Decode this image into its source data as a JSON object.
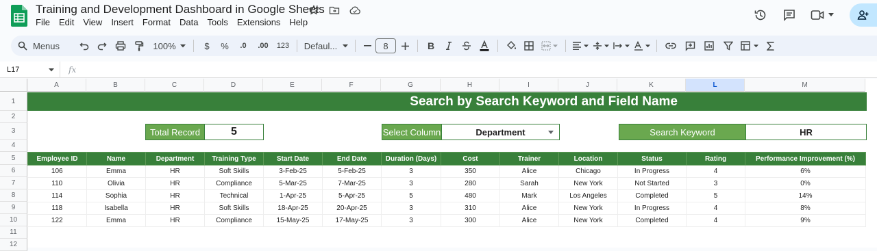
{
  "app": {
    "title": "Training and Development Dashboard in Google Sheets",
    "menu": [
      "File",
      "Edit",
      "View",
      "Insert",
      "Format",
      "Data",
      "Tools",
      "Extensions",
      "Help"
    ]
  },
  "toolbar": {
    "menus_label": "Menus",
    "zoom": "100%",
    "currency": "$",
    "percent": "%",
    "dec_decrease": ".0",
    "dec_increase": ".00",
    "number_format": "123",
    "font": "Defaul...",
    "font_size": "8",
    "bold": "B"
  },
  "formula_bar": {
    "cell_ref": "L17",
    "fx": "fx",
    "formula": ""
  },
  "columns": [
    "A",
    "B",
    "C",
    "D",
    "E",
    "F",
    "G",
    "H",
    "I",
    "J",
    "K",
    "L",
    "M"
  ],
  "selected_column": "L",
  "rows": [
    "1",
    "2",
    "3",
    "4",
    "5",
    "6",
    "7",
    "8",
    "9",
    "10",
    "11",
    "12"
  ],
  "dashboard": {
    "banner": "Search by Search Keyword and Field Name",
    "total_record_label": "Total Record",
    "total_record_value": "5",
    "select_column_label": "Select Column",
    "select_column_value": "Department",
    "search_keyword_label": "Search Keyword",
    "search_keyword_value": "HR"
  },
  "table": {
    "headers": [
      "Employee ID",
      "Name",
      "Department",
      "Training Type",
      "Start Date",
      "End Date",
      "Duration (Days)",
      "Cost",
      "Trainer",
      "Location",
      "Status",
      "Rating",
      "Performance Improvement (%)"
    ],
    "rows": [
      [
        "106",
        "Emma",
        "HR",
        "Soft Skills",
        "3-Feb-25",
        "5-Feb-25",
        "3",
        "350",
        "Alice",
        "Chicago",
        "In Progress",
        "4",
        "6%"
      ],
      [
        "110",
        "Olivia",
        "HR",
        "Compliance",
        "5-Mar-25",
        "7-Mar-25",
        "3",
        "280",
        "Sarah",
        "New York",
        "Not Started",
        "3",
        "0%"
      ],
      [
        "114",
        "Sophia",
        "HR",
        "Technical",
        "1-Apr-25",
        "5-Apr-25",
        "5",
        "480",
        "Mark",
        "Los Angeles",
        "Completed",
        "5",
        "14%"
      ],
      [
        "118",
        "Isabella",
        "HR",
        "Soft Skills",
        "18-Apr-25",
        "20-Apr-25",
        "3",
        "310",
        "Alice",
        "New York",
        "In Progress",
        "4",
        "8%"
      ],
      [
        "122",
        "Emma",
        "HR",
        "Compliance",
        "15-May-25",
        "17-May-25",
        "3",
        "300",
        "Alice",
        "New York",
        "Completed",
        "4",
        "9%"
      ]
    ]
  },
  "colors": {
    "banner_green": "#38803a",
    "label_green": "#6aa84f",
    "sheets_green": "#0f9d58"
  }
}
